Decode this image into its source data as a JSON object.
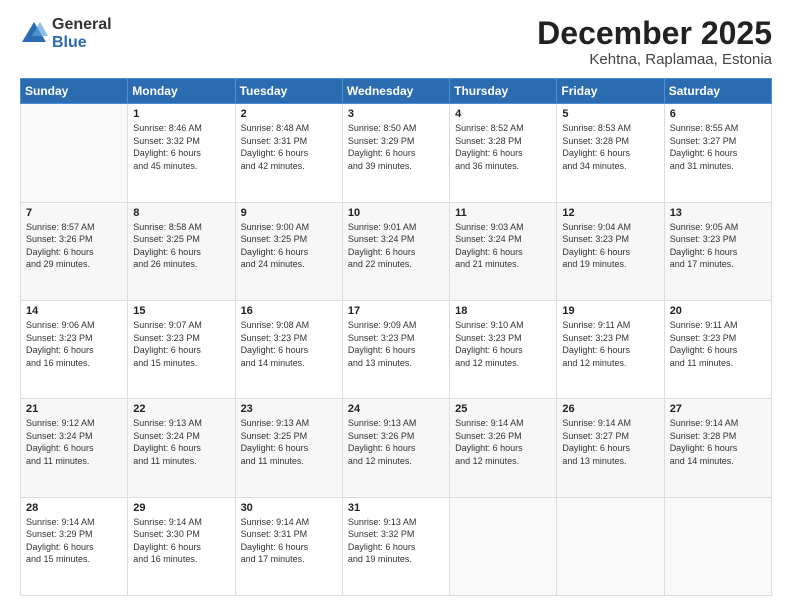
{
  "logo": {
    "general": "General",
    "blue": "Blue"
  },
  "header": {
    "title": "December 2025",
    "subtitle": "Kehtna, Raplamaa, Estonia"
  },
  "days_of_week": [
    "Sunday",
    "Monday",
    "Tuesday",
    "Wednesday",
    "Thursday",
    "Friday",
    "Saturday"
  ],
  "weeks": [
    [
      {
        "day": "",
        "info": ""
      },
      {
        "day": "1",
        "info": "Sunrise: 8:46 AM\nSunset: 3:32 PM\nDaylight: 6 hours\nand 45 minutes."
      },
      {
        "day": "2",
        "info": "Sunrise: 8:48 AM\nSunset: 3:31 PM\nDaylight: 6 hours\nand 42 minutes."
      },
      {
        "day": "3",
        "info": "Sunrise: 8:50 AM\nSunset: 3:29 PM\nDaylight: 6 hours\nand 39 minutes."
      },
      {
        "day": "4",
        "info": "Sunrise: 8:52 AM\nSunset: 3:28 PM\nDaylight: 6 hours\nand 36 minutes."
      },
      {
        "day": "5",
        "info": "Sunrise: 8:53 AM\nSunset: 3:28 PM\nDaylight: 6 hours\nand 34 minutes."
      },
      {
        "day": "6",
        "info": "Sunrise: 8:55 AM\nSunset: 3:27 PM\nDaylight: 6 hours\nand 31 minutes."
      }
    ],
    [
      {
        "day": "7",
        "info": "Sunrise: 8:57 AM\nSunset: 3:26 PM\nDaylight: 6 hours\nand 29 minutes."
      },
      {
        "day": "8",
        "info": "Sunrise: 8:58 AM\nSunset: 3:25 PM\nDaylight: 6 hours\nand 26 minutes."
      },
      {
        "day": "9",
        "info": "Sunrise: 9:00 AM\nSunset: 3:25 PM\nDaylight: 6 hours\nand 24 minutes."
      },
      {
        "day": "10",
        "info": "Sunrise: 9:01 AM\nSunset: 3:24 PM\nDaylight: 6 hours\nand 22 minutes."
      },
      {
        "day": "11",
        "info": "Sunrise: 9:03 AM\nSunset: 3:24 PM\nDaylight: 6 hours\nand 21 minutes."
      },
      {
        "day": "12",
        "info": "Sunrise: 9:04 AM\nSunset: 3:23 PM\nDaylight: 6 hours\nand 19 minutes."
      },
      {
        "day": "13",
        "info": "Sunrise: 9:05 AM\nSunset: 3:23 PM\nDaylight: 6 hours\nand 17 minutes."
      }
    ],
    [
      {
        "day": "14",
        "info": "Sunrise: 9:06 AM\nSunset: 3:23 PM\nDaylight: 6 hours\nand 16 minutes."
      },
      {
        "day": "15",
        "info": "Sunrise: 9:07 AM\nSunset: 3:23 PM\nDaylight: 6 hours\nand 15 minutes."
      },
      {
        "day": "16",
        "info": "Sunrise: 9:08 AM\nSunset: 3:23 PM\nDaylight: 6 hours\nand 14 minutes."
      },
      {
        "day": "17",
        "info": "Sunrise: 9:09 AM\nSunset: 3:23 PM\nDaylight: 6 hours\nand 13 minutes."
      },
      {
        "day": "18",
        "info": "Sunrise: 9:10 AM\nSunset: 3:23 PM\nDaylight: 6 hours\nand 12 minutes."
      },
      {
        "day": "19",
        "info": "Sunrise: 9:11 AM\nSunset: 3:23 PM\nDaylight: 6 hours\nand 12 minutes."
      },
      {
        "day": "20",
        "info": "Sunrise: 9:11 AM\nSunset: 3:23 PM\nDaylight: 6 hours\nand 11 minutes."
      }
    ],
    [
      {
        "day": "21",
        "info": "Sunrise: 9:12 AM\nSunset: 3:24 PM\nDaylight: 6 hours\nand 11 minutes."
      },
      {
        "day": "22",
        "info": "Sunrise: 9:13 AM\nSunset: 3:24 PM\nDaylight: 6 hours\nand 11 minutes."
      },
      {
        "day": "23",
        "info": "Sunrise: 9:13 AM\nSunset: 3:25 PM\nDaylight: 6 hours\nand 11 minutes."
      },
      {
        "day": "24",
        "info": "Sunrise: 9:13 AM\nSunset: 3:26 PM\nDaylight: 6 hours\nand 12 minutes."
      },
      {
        "day": "25",
        "info": "Sunrise: 9:14 AM\nSunset: 3:26 PM\nDaylight: 6 hours\nand 12 minutes."
      },
      {
        "day": "26",
        "info": "Sunrise: 9:14 AM\nSunset: 3:27 PM\nDaylight: 6 hours\nand 13 minutes."
      },
      {
        "day": "27",
        "info": "Sunrise: 9:14 AM\nSunset: 3:28 PM\nDaylight: 6 hours\nand 14 minutes."
      }
    ],
    [
      {
        "day": "28",
        "info": "Sunrise: 9:14 AM\nSunset: 3:29 PM\nDaylight: 6 hours\nand 15 minutes."
      },
      {
        "day": "29",
        "info": "Sunrise: 9:14 AM\nSunset: 3:30 PM\nDaylight: 6 hours\nand 16 minutes."
      },
      {
        "day": "30",
        "info": "Sunrise: 9:14 AM\nSunset: 3:31 PM\nDaylight: 6 hours\nand 17 minutes."
      },
      {
        "day": "31",
        "info": "Sunrise: 9:13 AM\nSunset: 3:32 PM\nDaylight: 6 hours\nand 19 minutes."
      },
      {
        "day": "",
        "info": ""
      },
      {
        "day": "",
        "info": ""
      },
      {
        "day": "",
        "info": ""
      }
    ]
  ]
}
